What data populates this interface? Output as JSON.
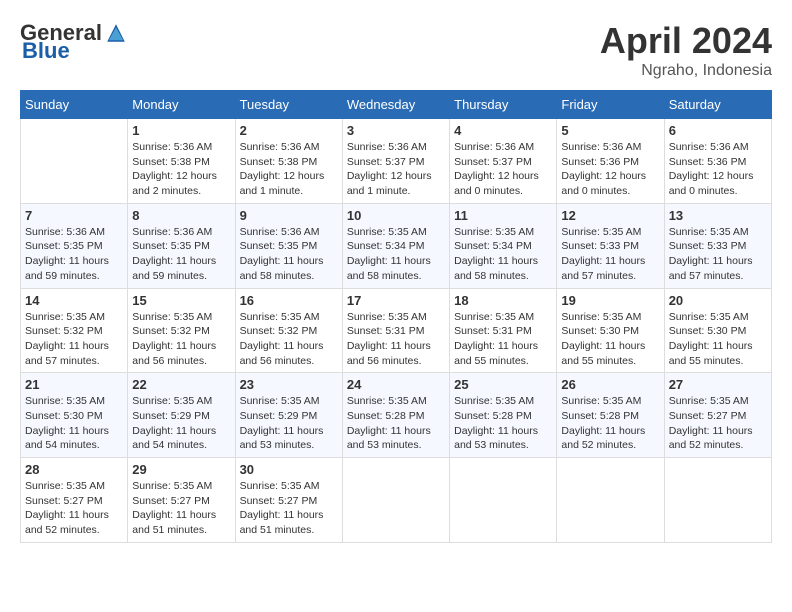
{
  "logo": {
    "general": "General",
    "blue": "Blue"
  },
  "title": "April 2024",
  "location": "Ngraho, Indonesia",
  "days_of_week": [
    "Sunday",
    "Monday",
    "Tuesday",
    "Wednesday",
    "Thursday",
    "Friday",
    "Saturday"
  ],
  "weeks": [
    [
      {
        "day": "",
        "info": ""
      },
      {
        "day": "1",
        "info": "Sunrise: 5:36 AM\nSunset: 5:38 PM\nDaylight: 12 hours\nand 2 minutes."
      },
      {
        "day": "2",
        "info": "Sunrise: 5:36 AM\nSunset: 5:38 PM\nDaylight: 12 hours\nand 1 minute."
      },
      {
        "day": "3",
        "info": "Sunrise: 5:36 AM\nSunset: 5:37 PM\nDaylight: 12 hours\nand 1 minute."
      },
      {
        "day": "4",
        "info": "Sunrise: 5:36 AM\nSunset: 5:37 PM\nDaylight: 12 hours\nand 0 minutes."
      },
      {
        "day": "5",
        "info": "Sunrise: 5:36 AM\nSunset: 5:36 PM\nDaylight: 12 hours\nand 0 minutes."
      },
      {
        "day": "6",
        "info": "Sunrise: 5:36 AM\nSunset: 5:36 PM\nDaylight: 12 hours\nand 0 minutes."
      }
    ],
    [
      {
        "day": "7",
        "info": ""
      },
      {
        "day": "8",
        "info": "Sunrise: 5:36 AM\nSunset: 5:35 PM\nDaylight: 11 hours\nand 59 minutes."
      },
      {
        "day": "9",
        "info": "Sunrise: 5:36 AM\nSunset: 5:35 PM\nDaylight: 11 hours\nand 58 minutes."
      },
      {
        "day": "10",
        "info": "Sunrise: 5:35 AM\nSunset: 5:34 PM\nDaylight: 11 hours\nand 58 minutes."
      },
      {
        "day": "11",
        "info": "Sunrise: 5:35 AM\nSunset: 5:34 PM\nDaylight: 11 hours\nand 58 minutes."
      },
      {
        "day": "12",
        "info": "Sunrise: 5:35 AM\nSunset: 5:33 PM\nDaylight: 11 hours\nand 57 minutes."
      },
      {
        "day": "13",
        "info": "Sunrise: 5:35 AM\nSunset: 5:33 PM\nDaylight: 11 hours\nand 57 minutes."
      }
    ],
    [
      {
        "day": "14",
        "info": ""
      },
      {
        "day": "15",
        "info": "Sunrise: 5:35 AM\nSunset: 5:32 PM\nDaylight: 11 hours\nand 56 minutes."
      },
      {
        "day": "16",
        "info": "Sunrise: 5:35 AM\nSunset: 5:32 PM\nDaylight: 11 hours\nand 56 minutes."
      },
      {
        "day": "17",
        "info": "Sunrise: 5:35 AM\nSunset: 5:31 PM\nDaylight: 11 hours\nand 56 minutes."
      },
      {
        "day": "18",
        "info": "Sunrise: 5:35 AM\nSunset: 5:31 PM\nDaylight: 11 hours\nand 55 minutes."
      },
      {
        "day": "19",
        "info": "Sunrise: 5:35 AM\nSunset: 5:30 PM\nDaylight: 11 hours\nand 55 minutes."
      },
      {
        "day": "20",
        "info": "Sunrise: 5:35 AM\nSunset: 5:30 PM\nDaylight: 11 hours\nand 55 minutes."
      }
    ],
    [
      {
        "day": "21",
        "info": ""
      },
      {
        "day": "22",
        "info": "Sunrise: 5:35 AM\nSunset: 5:29 PM\nDaylight: 11 hours\nand 54 minutes."
      },
      {
        "day": "23",
        "info": "Sunrise: 5:35 AM\nSunset: 5:29 PM\nDaylight: 11 hours\nand 53 minutes."
      },
      {
        "day": "24",
        "info": "Sunrise: 5:35 AM\nSunset: 5:28 PM\nDaylight: 11 hours\nand 53 minutes."
      },
      {
        "day": "25",
        "info": "Sunrise: 5:35 AM\nSunset: 5:28 PM\nDaylight: 11 hours\nand 53 minutes."
      },
      {
        "day": "26",
        "info": "Sunrise: 5:35 AM\nSunset: 5:28 PM\nDaylight: 11 hours\nand 52 minutes."
      },
      {
        "day": "27",
        "info": "Sunrise: 5:35 AM\nSunset: 5:27 PM\nDaylight: 11 hours\nand 52 minutes."
      }
    ],
    [
      {
        "day": "28",
        "info": "Sunrise: 5:35 AM\nSunset: 5:27 PM\nDaylight: 11 hours\nand 52 minutes."
      },
      {
        "day": "29",
        "info": "Sunrise: 5:35 AM\nSunset: 5:27 PM\nDaylight: 11 hours\nand 51 minutes."
      },
      {
        "day": "30",
        "info": "Sunrise: 5:35 AM\nSunset: 5:27 PM\nDaylight: 11 hours\nand 51 minutes."
      },
      {
        "day": "",
        "info": ""
      },
      {
        "day": "",
        "info": ""
      },
      {
        "day": "",
        "info": ""
      },
      {
        "day": "",
        "info": ""
      }
    ]
  ]
}
